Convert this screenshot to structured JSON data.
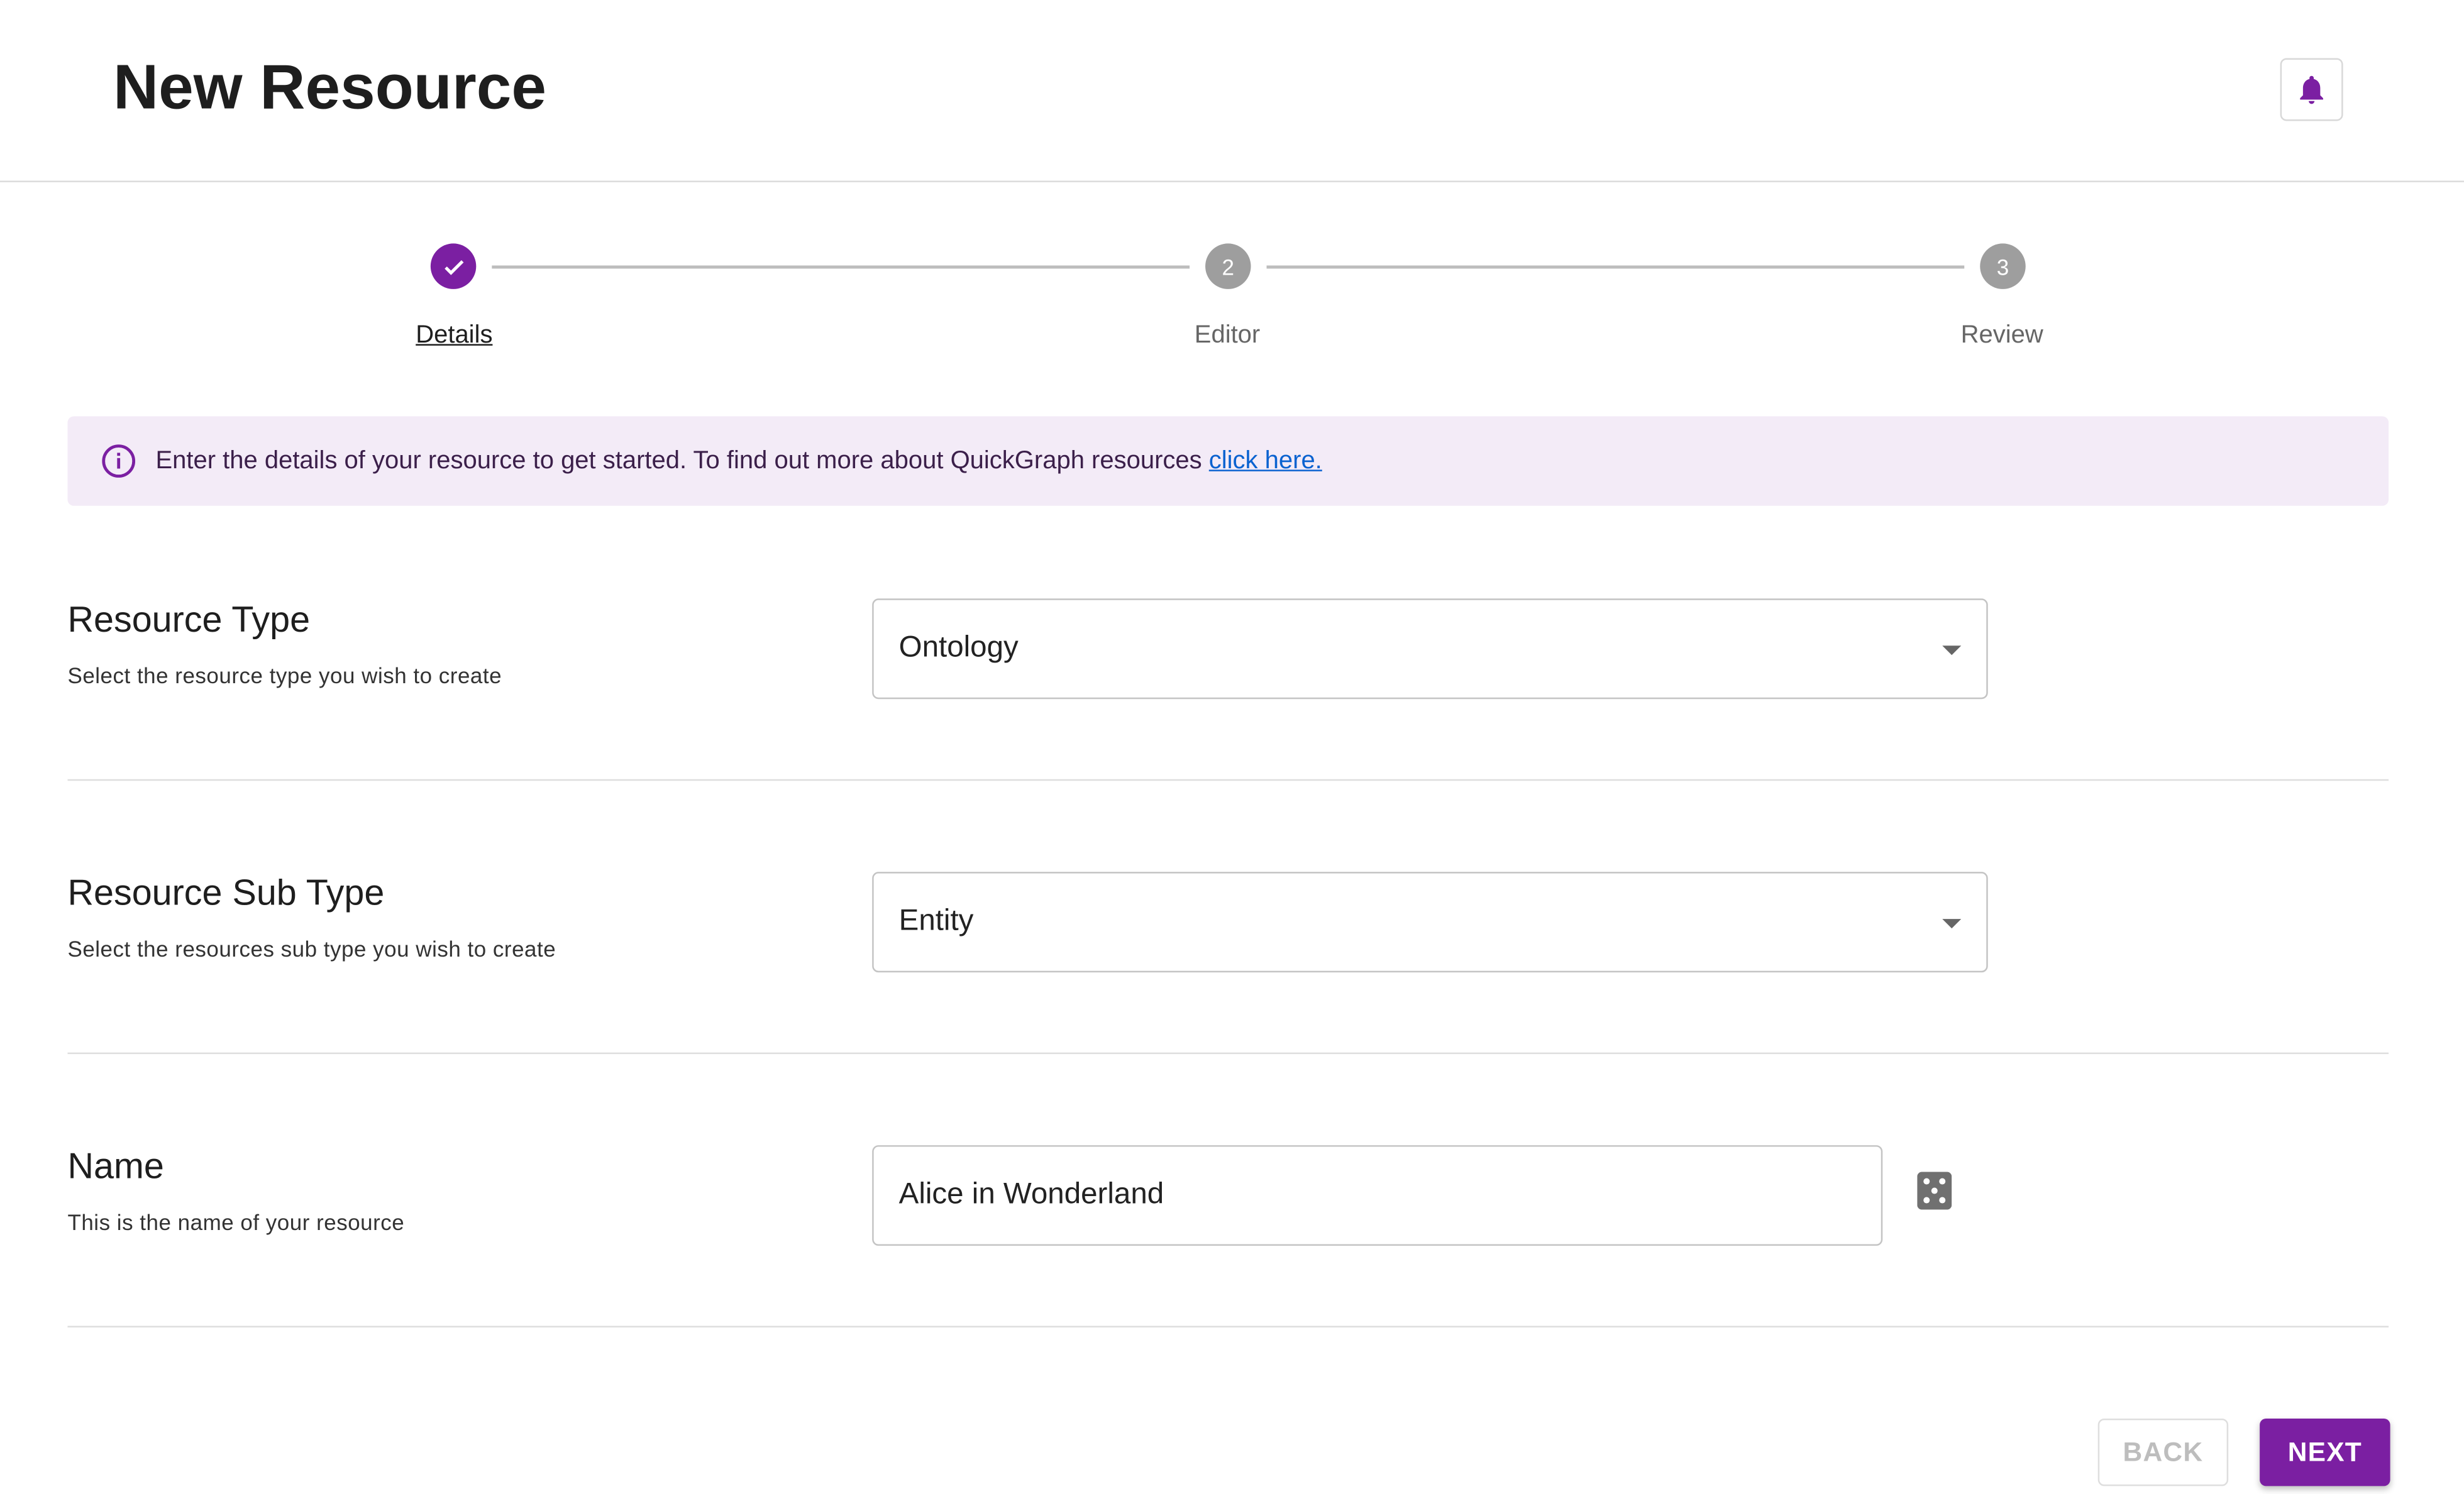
{
  "header": {
    "title": "New Resource",
    "notification_icon": "bell-icon"
  },
  "stepper": {
    "steps": [
      {
        "label": "Details",
        "number": "1",
        "state": "completed"
      },
      {
        "label": "Editor",
        "number": "2",
        "state": "inactive"
      },
      {
        "label": "Review",
        "number": "3",
        "state": "inactive"
      }
    ]
  },
  "alert": {
    "text": "Enter the details of your resource to get started. To find out more about QuickGraph resources",
    "link": "click here."
  },
  "form": {
    "resource_type": {
      "title": "Resource Type",
      "subtitle": "Select the resource type you wish to create",
      "value": "Ontology"
    },
    "resource_sub_type": {
      "title": "Resource Sub Type",
      "subtitle": "Select the resources sub type you wish to create",
      "value": "Entity"
    },
    "name": {
      "title": "Name",
      "subtitle": "This is the name of your resource",
      "value": "Alice in Wonderland"
    }
  },
  "actions": {
    "back": "BACK",
    "next": "NEXT"
  },
  "colors": {
    "accent": "#7b1fa2",
    "inactive_step": "#9e9e9e",
    "alert_bg": "#f3ebf7",
    "link": "#0a62d0"
  }
}
